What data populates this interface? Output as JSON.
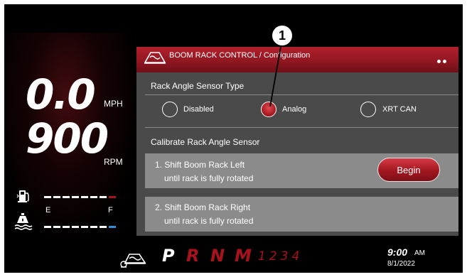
{
  "header": {
    "title": "BOOM RACK CONTROL / Configuration",
    "dots_count": 2,
    "icon": "boom-rack-icon"
  },
  "callout": {
    "number": "1"
  },
  "gauges": {
    "speed_value": "0.0",
    "speed_unit": "MPH",
    "rpm_value": "900",
    "rpm_unit": "RPM",
    "fuel_empty_label": "E",
    "fuel_full_label": "F",
    "fuel_icon": "fuel-pump-icon",
    "oil_icon": "oil-level-icon"
  },
  "sensor": {
    "heading": "Rack Angle Sensor Type",
    "options": [
      {
        "label": "Disabled",
        "selected": false
      },
      {
        "label": "Analog",
        "selected": true
      },
      {
        "label": "XRT CAN",
        "selected": false
      }
    ]
  },
  "calibrate": {
    "heading": "Calibrate Rack Angle Sensor",
    "steps": [
      {
        "title": "1. Shift Boom Rack Left",
        "subtitle": "until rack is fully rotated",
        "button": "Begin"
      },
      {
        "title": "2. Shift Boom Rack Right",
        "subtitle": "until rack is fully rotated"
      }
    ]
  },
  "status_bar": {
    "icon": "boom-rack-icon",
    "gears": [
      "P",
      "R",
      "N",
      "M"
    ],
    "active_gear": "P",
    "gear_numbers": "1234",
    "time": "9:00",
    "ampm": "AM",
    "date": "8/1/2022"
  },
  "colors": {
    "accent_red": "#a1151d",
    "panel_gray": "#4a4a4a",
    "card_gray": "#8b8b8b",
    "fuel_indicator": "#2f8fd8"
  }
}
